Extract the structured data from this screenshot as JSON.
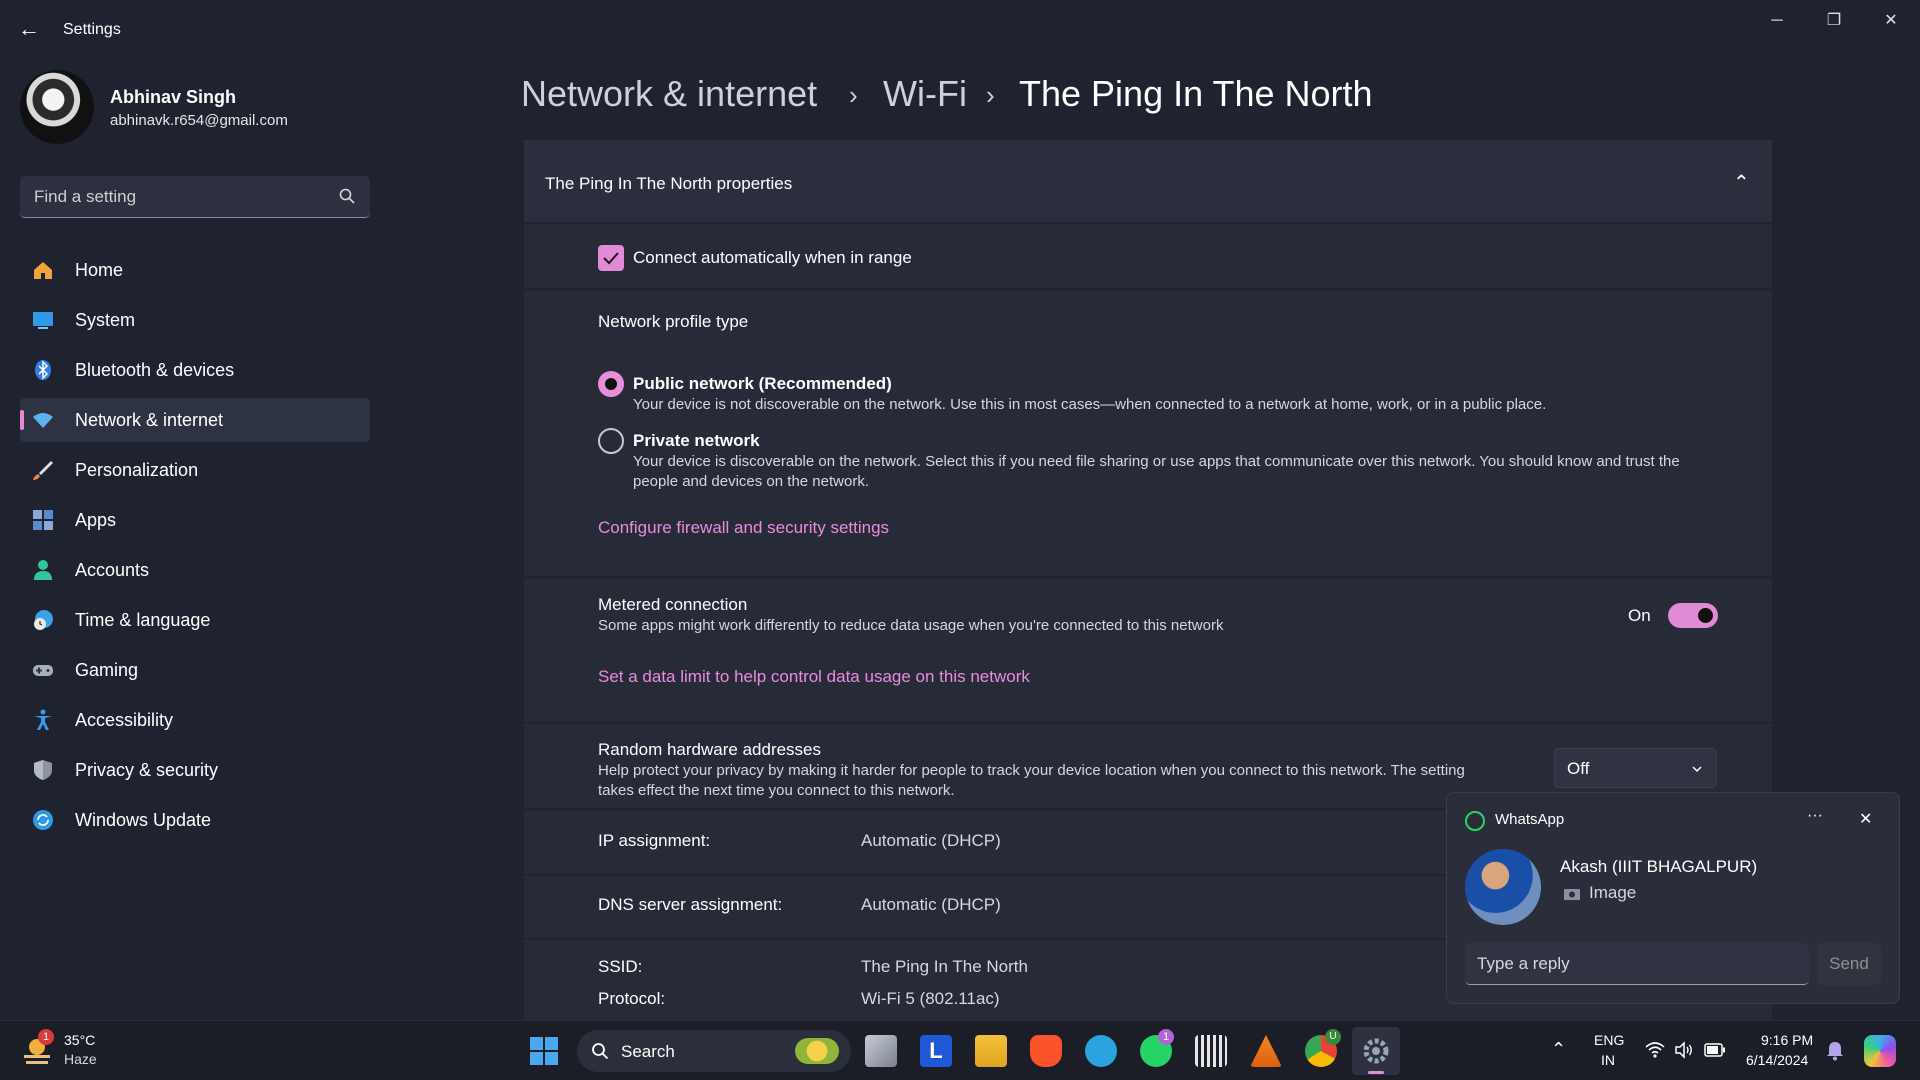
{
  "window": {
    "title": "Settings",
    "back_glyph": "←",
    "minimize_glyph": "─",
    "restore_glyph": "❐",
    "close_glyph": "✕"
  },
  "profile": {
    "name": "Abhinav Singh",
    "email": "abhinavk.r654@gmail.com"
  },
  "search": {
    "placeholder": "Find a setting"
  },
  "nav": {
    "items": [
      {
        "label": "Home",
        "icon": "home-icon",
        "color": "#f2a33a"
      },
      {
        "label": "System",
        "icon": "system-icon",
        "color": "#2f9be6"
      },
      {
        "label": "Bluetooth & devices",
        "icon": "bluetooth-icon",
        "color": "#2f7fe6"
      },
      {
        "label": "Network & internet",
        "icon": "wifi-icon",
        "color": "#5ab3f0"
      },
      {
        "label": "Personalization",
        "icon": "brush-icon",
        "color": "#e8884a"
      },
      {
        "label": "Apps",
        "icon": "apps-icon",
        "color": "#8aa9d6"
      },
      {
        "label": "Accounts",
        "icon": "accounts-icon",
        "color": "#2fc79a"
      },
      {
        "label": "Time & language",
        "icon": "clock-globe-icon",
        "color": "#3aa0e8"
      },
      {
        "label": "Gaming",
        "icon": "gamepad-icon",
        "color": "#a8b0bf"
      },
      {
        "label": "Accessibility",
        "icon": "accessibility-icon",
        "color": "#3a9af0"
      },
      {
        "label": "Privacy & security",
        "icon": "shield-icon",
        "color": "#8c93a3"
      },
      {
        "label": "Windows Update",
        "icon": "update-icon",
        "color": "#2f9be6"
      }
    ],
    "active_index": 3
  },
  "breadcrumb": {
    "items": [
      "Network & internet",
      "Wi-Fi",
      "The Ping In The North"
    ],
    "separator": "›"
  },
  "properties": {
    "header": "The Ping In The North  properties",
    "collapse_glyph": "⌃",
    "connect_auto": {
      "label": "Connect automatically when in range",
      "checked": true
    },
    "profile_type": {
      "title": "Network profile type",
      "options": [
        {
          "label": "Public network (Recommended)",
          "desc": "Your device is not discoverable on the network. Use this in most cases—when connected to a network at home, work, or in a public place.",
          "selected": true
        },
        {
          "label": "Private network",
          "desc_line1": "Your device is discoverable on the network. Select this if you need file sharing or use apps that communicate over this network. You should know and trust the",
          "desc_line2": "people and devices on the network.",
          "selected": false
        }
      ],
      "firewall_link": "Configure firewall and security settings"
    },
    "metered": {
      "title": "Metered connection",
      "desc": "Some apps might work differently to reduce data usage when you're connected to this network",
      "state_label": "On",
      "on": true,
      "data_limit_link": "Set a data limit to help control data usage on this network"
    },
    "random_hw": {
      "title": "Random hardware addresses",
      "desc_line1": "Help protect your privacy by making it harder for people to track your device location when you connect to this network. The setting",
      "desc_line2": "takes effect the next time you connect to this network.",
      "value": "Off"
    },
    "ip": {
      "label": "IP assignment:",
      "value": "Automatic (DHCP)"
    },
    "dns": {
      "label": "DNS server assignment:",
      "value": "Automatic (DHCP)"
    },
    "ssid": {
      "label": "SSID:",
      "value": "The Ping In The North"
    },
    "protocol": {
      "label": "Protocol:",
      "value": "Wi-Fi 5 (802.11ac)"
    }
  },
  "toast": {
    "app": "WhatsApp",
    "more_glyph": "···",
    "close_glyph": "✕",
    "sender": "Akash (IIIT BHAGALPUR)",
    "message": "Image",
    "reply_placeholder": "Type a reply",
    "send_label": "Send"
  },
  "taskbar": {
    "weather_temp": "35°C",
    "weather_desc": "Haze",
    "weather_badge": "1",
    "search_label": "Search",
    "whatsapp_badge": "1",
    "chrome_badge": "U",
    "lang_top": "ENG",
    "lang_bottom": "IN",
    "time": "9:16 PM",
    "date": "6/14/2024",
    "overflow_glyph": "⌃",
    "letter_app": "L"
  }
}
